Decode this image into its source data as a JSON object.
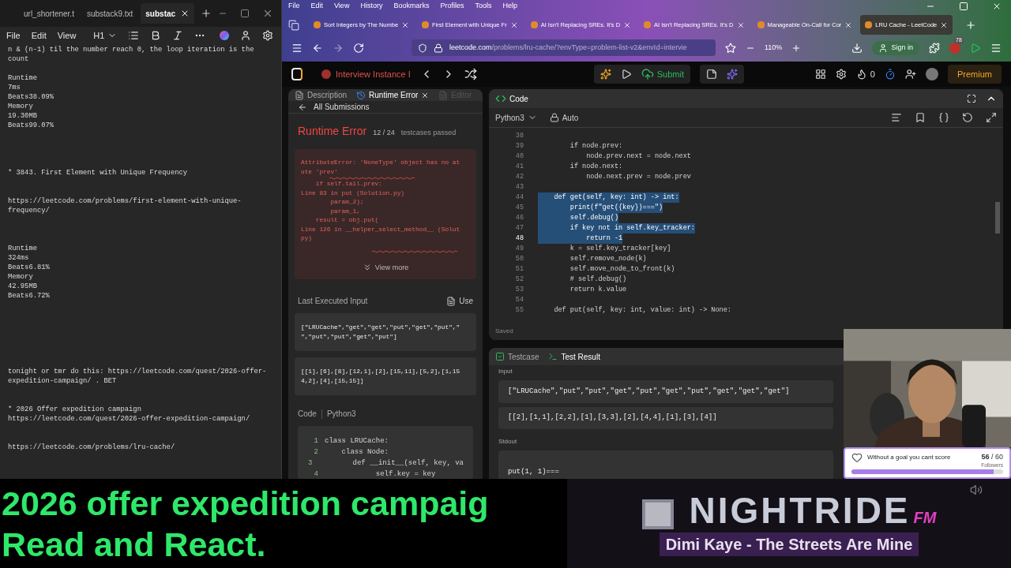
{
  "notepad": {
    "tabs": [
      {
        "label": "url_shortener.t",
        "selected": false
      },
      {
        "label": "substack9.txt",
        "selected": false
      },
      {
        "label": "substac",
        "selected": true
      }
    ],
    "menu": [
      "File",
      "Edit",
      "View"
    ],
    "heading": "H1",
    "text": "n & (n-1) til the number reach 0, the loop iteration is the\ncount\n\nRuntime\n7ms\nBeats38.09%\nMemory\n19.30MB\nBeats99.07%\n\n\n\n\n* 3843. First Element with Unique Frequency\n\n\nhttps://leetcode.com/problems/first-element-with-unique-\nfrequency/\n\n\n\nRuntime\n324ms\nBeats6.81%\nMemory\n42.95MB\nBeats6.72%\n\n\n\n\n\n\n\ntonight or tmr do this: https://leetcode.com/quest/2026-offer-\nexpedition-campaign/ . BET\n\n\n* 2026 Offer expedition campaign\nhttps://leetcode.com/quest/2026-offer-expedition-campaign/\n\n\nhttps://leetcode.com/problems/lru-cache/"
  },
  "browser": {
    "menu": [
      "File",
      "Edit",
      "View",
      "History",
      "Bookmarks",
      "Profiles",
      "Tools",
      "Help"
    ],
    "tabs": [
      {
        "label": "Sort Integers by The Numbe",
        "selected": false
      },
      {
        "label": "First Element with Unique Fr",
        "selected": false
      },
      {
        "label": "AI Isn't Replacing SREs. It's D",
        "selected": false
      },
      {
        "label": "AI Isn't Replacing SREs. It's D",
        "selected": false
      },
      {
        "label": "Manageable On-Call for Cor",
        "selected": false
      },
      {
        "label": "LRU Cache - LeetCode",
        "selected": true
      }
    ],
    "url_host": "leetcode.com",
    "url_path": "/problems/lru-cache/?envType=problem-list-v2&envId=intervie",
    "zoom": "110%",
    "sign_in": "Sign in",
    "badge": "78"
  },
  "leetcode": {
    "session": "Interview Instance I",
    "submit": "Submit",
    "streak": "0",
    "premium": "Premium",
    "left_tabs": [
      {
        "label": "Description",
        "selected": false,
        "disabled": false
      },
      {
        "label": "Runtime Error",
        "selected": true,
        "disabled": false
      },
      {
        "label": "Editor",
        "selected": false,
        "disabled": true
      }
    ],
    "back": "All Submissions",
    "result": "Runtime Error",
    "passed": "12 / 24",
    "passed_label": "testcases passed",
    "error_lines": [
      "AttributeError: 'NoneType' object has no at",
      "ute 'prev'",
      "    if self.tail.prev:",
      "Line 83 in put (Solution.py)",
      "        param_2);",
      "        param_1,",
      "    result = obj.put(",
      "Line 126 in __helper_select_method__ (Solut",
      "py)"
    ],
    "view_more": "View more",
    "last_input_label": "Last Executed Input",
    "use_label": "Use",
    "last_input": [
      "[\"LRUCache\",\"get\",\"get\",\"put\",\"get\",\"put\",\"\n\",\"put\",\"put\",\"get\",\"put\"]",
      "[[1],[6],[8],[12,1],[2],[15,11],[5,2],[1,15\n4,2],[4],[15,15]]"
    ],
    "code_label": "Code",
    "code_lang": "Python3",
    "submitted_code": [
      {
        "num": "1",
        "text": "class LRUCache:"
      },
      {
        "num": "2",
        "text": "    class Node:"
      },
      {
        "num": "3",
        "text": "        def __init__(self, key, va"
      },
      {
        "num": "4",
        "text": "            self.key = key"
      }
    ],
    "editor_title": "Code",
    "language": "Python3",
    "mode": "Auto",
    "editor_lines": [
      {
        "num": "38",
        "selected": false,
        "current": false
      },
      {
        "num": "39",
        "text": "        if node.prev:",
        "selected": false,
        "current": false
      },
      {
        "num": "40",
        "text": "            node.prev.next = node.next",
        "selected": false,
        "current": false
      },
      {
        "num": "41",
        "text": "        if node.next:",
        "selected": false,
        "current": false
      },
      {
        "num": "42",
        "text": "            node.next.prev = node.prev",
        "selected": false,
        "current": false
      },
      {
        "num": "43",
        "selected": false,
        "current": false
      },
      {
        "num": "44",
        "text": "    def get(self, key: int) -> int:",
        "selected": true,
        "current": false
      },
      {
        "num": "45",
        "text": "        print(f\"get({key})===\")",
        "selected": true,
        "current": false
      },
      {
        "num": "46",
        "text": "        self.debug()",
        "selected": true,
        "current": false
      },
      {
        "num": "47",
        "text": "        if key not in self.key_tracker:",
        "selected": true,
        "current": false
      },
      {
        "num": "48",
        "text": "            return -1",
        "selected": true,
        "current": true
      },
      {
        "num": "49",
        "text": "        k = self.key_tracker[key]",
        "selected": false,
        "current": false
      },
      {
        "num": "50",
        "text": "        self.remove_node(k)",
        "selected": false,
        "current": false
      },
      {
        "num": "51",
        "text": "        self.move_node_to_front(k)",
        "selected": false,
        "current": false
      },
      {
        "num": "52",
        "text": "        # self.debug()",
        "selected": false,
        "current": false
      },
      {
        "num": "53",
        "text": "        return k.value",
        "selected": false,
        "current": false
      },
      {
        "num": "54",
        "selected": false,
        "current": false
      },
      {
        "num": "55",
        "text": "    def put(self, key: int, value: int) -> None:",
        "selected": false,
        "current": false
      }
    ],
    "saved": "Saved",
    "bottom_tabs": [
      {
        "label": "Testcase",
        "selected": false
      },
      {
        "label": "Test Result",
        "selected": true
      }
    ],
    "input_label": "Input",
    "inputs": [
      "[\"LRUCache\",\"put\",\"put\",\"get\",\"put\",\"get\",\"put\",\"get\",\"get\",\"get\"]",
      "[[2],[1,1],[2,2],[1],[3,3],[2],[4,4],[1],[3],[4]]"
    ],
    "stdout_label": "Stdout",
    "stdout": "put(1, 1)==="
  },
  "webcam": {
    "kind": "picture",
    "goal": {
      "title": "Without a goal you cant score",
      "current": "56",
      "total": "/ 60",
      "unit": "Followers",
      "level": 0.94
    }
  },
  "overlay": {
    "caption_lines": [
      "2026 offer expedition campaig",
      "Read and React."
    ],
    "station": "NIGHTRIDE",
    "station_suffix": "FM",
    "now_playing": "Dimi Kaye - The Streets Are Mine"
  }
}
